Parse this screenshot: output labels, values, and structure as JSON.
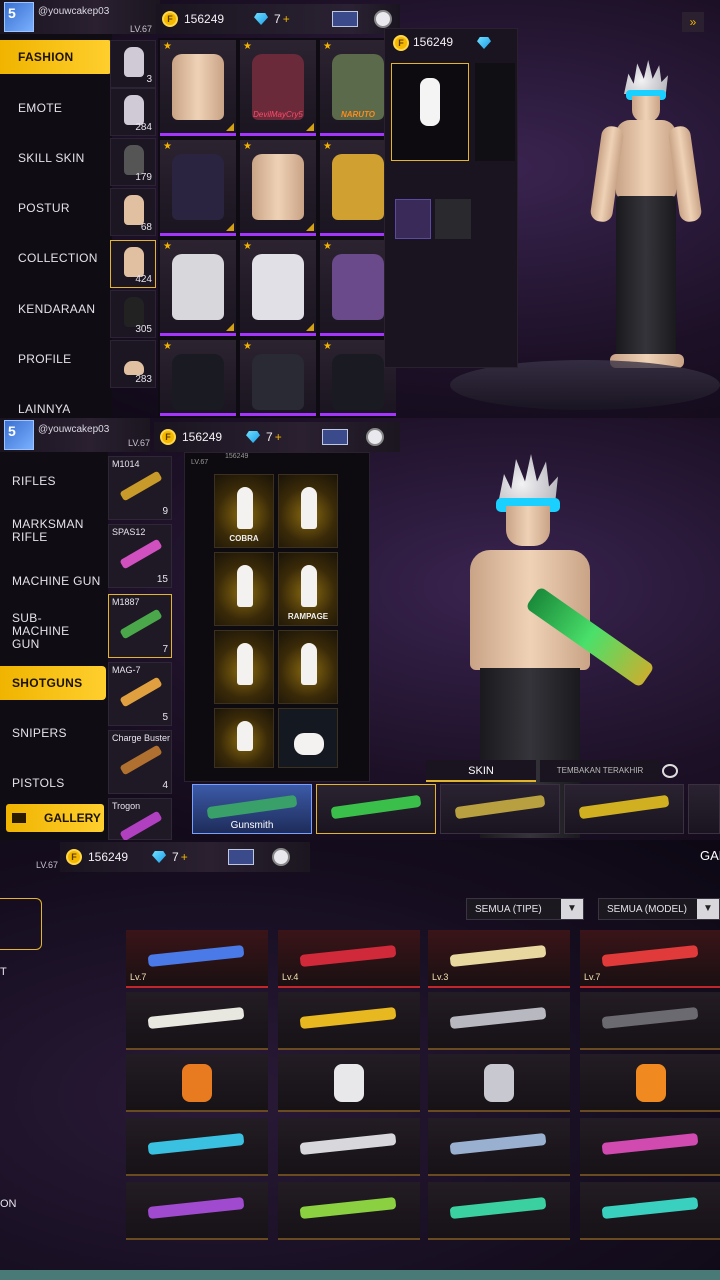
{
  "panel1": {
    "user": {
      "name": "@youwcakep03",
      "level": "LV.67",
      "badge": "5"
    },
    "currency": {
      "coins": "156249",
      "diamonds": "7",
      "plus": "+"
    },
    "sidebar": [
      {
        "label": "FASHION",
        "active": true
      },
      {
        "label": "EMOTE",
        "active": false
      },
      {
        "label": "SKILL SKIN",
        "active": false
      },
      {
        "label": "POSTUR",
        "active": false
      },
      {
        "label": "COLLECTION",
        "active": false
      },
      {
        "label": "KENDARAAN",
        "active": false
      },
      {
        "label": "PROFILE",
        "active": false
      },
      {
        "label": "LAINNYA",
        "active": false
      }
    ],
    "category_counts": [
      "3",
      "284",
      "179",
      "68",
      "424",
      "305",
      "283"
    ],
    "cards": [
      {
        "caption": ""
      },
      {
        "caption": "DevilMayCry5"
      },
      {
        "caption": "NARUTO"
      },
      {
        "caption": ""
      },
      {
        "caption": ""
      },
      {
        "caption": ""
      },
      {
        "caption": ""
      },
      {
        "caption": ""
      },
      {
        "caption": ""
      },
      {
        "caption": ""
      },
      {
        "caption": ""
      },
      {
        "caption": ""
      }
    ],
    "overlay": {
      "coins": "156249"
    }
  },
  "panel2": {
    "user": {
      "name": "@youwcakep03",
      "level": "LV.67",
      "badge": "5"
    },
    "currency": {
      "coins": "156249",
      "diamonds": "7",
      "plus": "+"
    },
    "sidebar": [
      {
        "label": "RIFLES",
        "active": false
      },
      {
        "label": "MARKSMAN RIFLE",
        "active": false
      },
      {
        "label": "MACHINE GUN",
        "active": false
      },
      {
        "label": "SUB-MACHINE GUN",
        "active": false
      },
      {
        "label": "SHOTGUNS",
        "active": true
      },
      {
        "label": "SNIPERS",
        "active": false
      },
      {
        "label": "PISTOLS",
        "active": false
      }
    ],
    "gallery_button": "GALLERY",
    "weapons": [
      {
        "name": "M1014",
        "count": "9",
        "color": "#c89a2a"
      },
      {
        "name": "SPAS12",
        "count": "15",
        "color": "#d050c0"
      },
      {
        "name": "M1887",
        "count": "7",
        "color": "#4aa84a"
      },
      {
        "name": "MAG-7",
        "count": "5",
        "color": "#e0a040"
      },
      {
        "name": "Charge Buster",
        "count": "4",
        "color": "#b07030"
      },
      {
        "name": "Trogon",
        "count": "",
        "color": "#b040c0"
      }
    ],
    "emote_labels": [
      "COBRA",
      "",
      "",
      "RAMPAGE",
      "",
      "",
      "",
      ""
    ],
    "tabs": {
      "skin": "SKIN",
      "recent": "TEMBAKAN TERAKHIR"
    },
    "skin_strip": [
      {
        "label": "Gunsmith",
        "color": "#3aa06a"
      },
      {
        "label": "",
        "color": "#3ac04a"
      },
      {
        "label": "",
        "color": "#b8a040"
      },
      {
        "label": "",
        "color": "#d0b020"
      }
    ],
    "mini_level": "LV.67",
    "mini_coins": "156249"
  },
  "panel3": {
    "level": "LV.67",
    "currency": {
      "coins": "156249",
      "diamonds": "7",
      "plus": "+"
    },
    "title_partial": "GAL",
    "filters": {
      "type": "SEMUA (TIPE)",
      "model": "SEMUA (MODEL)"
    },
    "side_letters": [
      "T",
      "ON"
    ],
    "grid": [
      {
        "lv": "Lv.7",
        "color": "#4a7ae8",
        "red": true,
        "kind": "gun"
      },
      {
        "lv": "Lv.4",
        "color": "#d02a3a",
        "red": true,
        "kind": "gun"
      },
      {
        "lv": "Lv.3",
        "color": "#e8d8a0",
        "red": true,
        "kind": "gun"
      },
      {
        "lv": "Lv.7",
        "color": "#e03a3a",
        "red": true,
        "kind": "gun"
      },
      {
        "lv": "",
        "color": "#e8e8e0",
        "red": false,
        "kind": "gun"
      },
      {
        "lv": "",
        "color": "#e8b820",
        "red": false,
        "kind": "gun"
      },
      {
        "lv": "",
        "color": "#b8b8c0",
        "red": false,
        "kind": "gun"
      },
      {
        "lv": "",
        "color": "#6a6a70",
        "red": false,
        "kind": "gun"
      },
      {
        "lv": "",
        "color": "#e87a20",
        "red": false,
        "kind": "item"
      },
      {
        "lv": "",
        "color": "#e8e8ea",
        "red": false,
        "kind": "item"
      },
      {
        "lv": "",
        "color": "#c8c8d0",
        "red": false,
        "kind": "item"
      },
      {
        "lv": "",
        "color": "#f08a20",
        "red": false,
        "kind": "item"
      },
      {
        "lv": "",
        "color": "#3ac0e0",
        "red": false,
        "kind": "gun"
      },
      {
        "lv": "",
        "color": "#d8d8dc",
        "red": false,
        "kind": "gun"
      },
      {
        "lv": "",
        "color": "#9ab0d0",
        "red": false,
        "kind": "gun"
      },
      {
        "lv": "",
        "color": "#d04ab0",
        "red": false,
        "kind": "gun"
      },
      {
        "lv": "",
        "color": "#a04ad0",
        "red": false,
        "kind": "gun"
      },
      {
        "lv": "",
        "color": "#8ad040",
        "red": false,
        "kind": "gun"
      },
      {
        "lv": "",
        "color": "#3ad0a0",
        "red": false,
        "kind": "gun"
      },
      {
        "lv": "",
        "color": "#3ad0c0",
        "red": false,
        "kind": "gun"
      }
    ]
  },
  "colors": {
    "accent": "#f0b400",
    "rare": "#a335ff",
    "coin": "#f5b800"
  }
}
